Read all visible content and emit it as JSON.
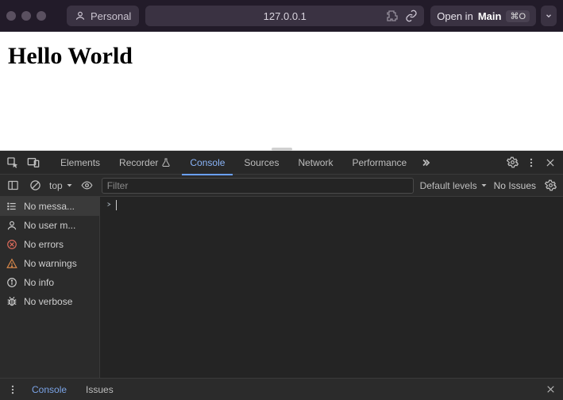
{
  "browser": {
    "profile_label": "Personal",
    "url": "127.0.0.1",
    "open_in": {
      "prefix": "Open in",
      "target": "Main",
      "shortcut": "⌘O"
    }
  },
  "page": {
    "heading": "Hello World"
  },
  "devtools": {
    "tabs": {
      "elements": "Elements",
      "recorder": "Recorder",
      "console": "Console",
      "sources": "Sources",
      "network": "Network",
      "performance": "Performance"
    },
    "toolbar": {
      "context": "top",
      "filter_placeholder": "Filter",
      "levels": "Default levels",
      "issues": "No Issues"
    },
    "sidebar": {
      "messages": "No messa...",
      "user": "No user m...",
      "errors": "No errors",
      "warnings": "No warnings",
      "info": "No info",
      "verbose": "No verbose"
    },
    "drawer": {
      "console": "Console",
      "issues": "Issues"
    }
  }
}
